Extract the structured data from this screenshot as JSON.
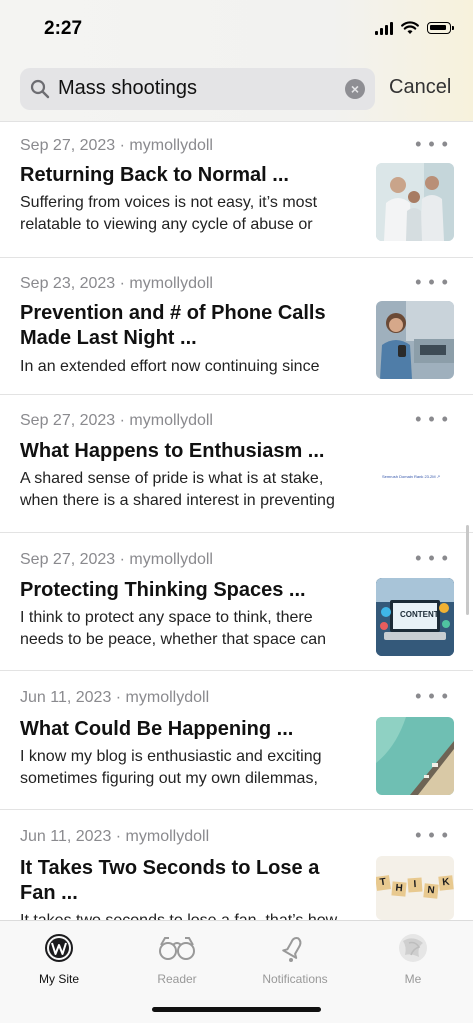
{
  "status_bar": {
    "time": "2:27"
  },
  "search": {
    "query": "Mass shootings",
    "cancel_label": "Cancel"
  },
  "posts": [
    {
      "meta": "Sep 27, 2023 · mymollydoll",
      "title_lines": [
        "Returning Back to Normal ..."
      ],
      "excerpt_lines": [
        "Suffering from voices is not easy, it’s most",
        "relatable to viewing any cycle of abuse or"
      ],
      "thumb": "office-meeting-photo"
    },
    {
      "meta": "Sep 23, 2023 · mymollydoll",
      "title_lines": [
        "Prevention and # of Phone Calls",
        "Made Last Night ..."
      ],
      "excerpt_lines": [
        "In an extended effort now continuing since"
      ],
      "thumb": "woman-phone-photo"
    },
    {
      "meta": "Sep 27, 2023 · mymollydoll",
      "title_lines": [
        "What Happens to Enthusiasm ..."
      ],
      "excerpt_lines": [
        "A shared sense of pride is what is at stake,",
        "when there is a shared interest in preventing"
      ],
      "thumb": "semrush-chart-image",
      "thumb_caption": "Semrush Domain Rank  23.2M ↗"
    },
    {
      "meta": "Sep 27, 2023 · mymollydoll",
      "title_lines": [
        "Protecting Thinking Spaces ..."
      ],
      "excerpt_lines": [
        "I think to protect any space to think, there",
        "needs to be peace, whether that space can"
      ],
      "thumb": "content-laptop-photo",
      "thumb_caption": "CONTENT"
    },
    {
      "meta": "Jun 11, 2023 · mymollydoll",
      "title_lines": [
        "What Could Be Happening ..."
      ],
      "excerpt_lines": [
        "I know my blog is enthusiastic and exciting",
        "sometimes figuring out my own dilemmas,"
      ],
      "thumb": "beach-aerial-photo"
    },
    {
      "meta": "Jun 11, 2023 · mymollydoll",
      "title_lines": [
        "It Takes Two Seconds to Lose a",
        "Fan ..."
      ],
      "excerpt_lines": [
        "It takes two seconds to lose a fan, that’s how"
      ],
      "thumb": "think-scrabble-tiles",
      "thumb_tiles": [
        "T",
        "H",
        "I",
        "N",
        "K"
      ]
    }
  ],
  "tabs": [
    {
      "label": "My Site",
      "icon": "wordpress-icon",
      "active": true
    },
    {
      "label": "Reader",
      "icon": "glasses-icon",
      "active": false
    },
    {
      "label": "Notifications",
      "icon": "bell-icon",
      "active": false
    },
    {
      "label": "Me",
      "icon": "avatar-icon",
      "active": false
    }
  ]
}
